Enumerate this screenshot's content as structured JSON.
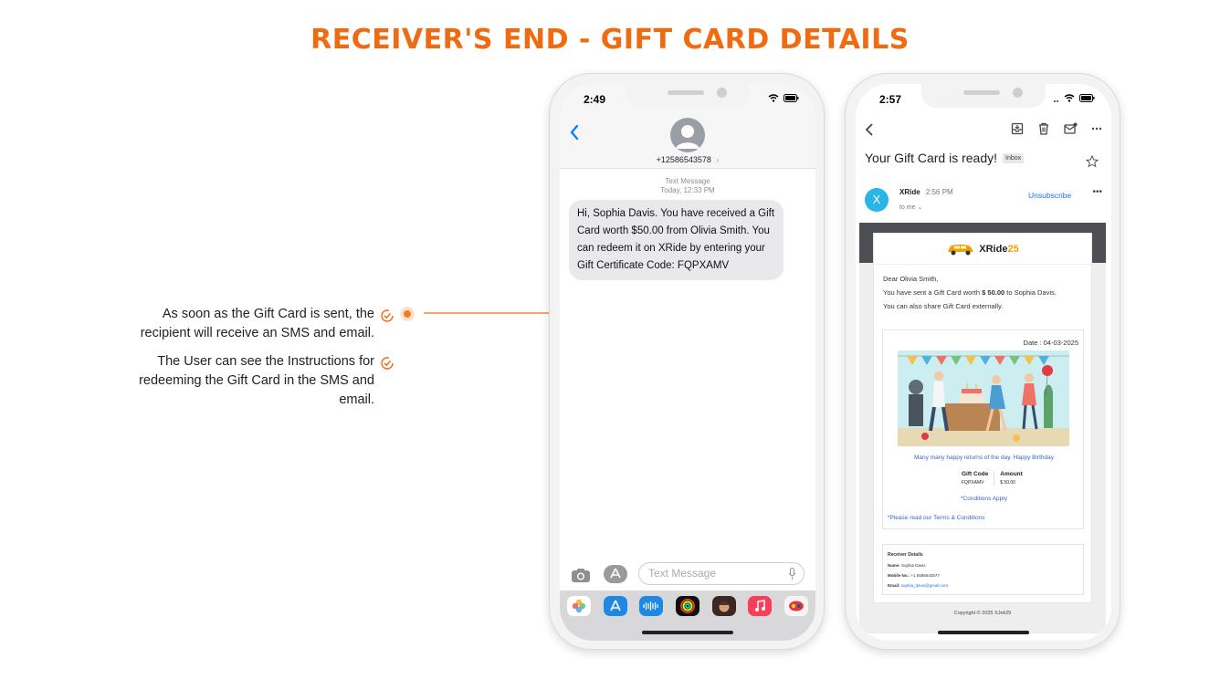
{
  "page": {
    "title": "RECEIVER'S END - GIFT CARD DETAILS"
  },
  "notes": [
    "As soon as the Gift Card is sent, the recipient will receive an SMS and email.",
    "The User can see the Instructions for redeeming the Gift Card in the SMS and email."
  ],
  "colors": {
    "accent": "#f06b0f",
    "imessage_blue": "#007aff",
    "link_blue": "#1a73e8"
  },
  "sms_phone": {
    "time": "2:49",
    "contact_number": "+12586543578",
    "meta_label": "Text Message",
    "meta_time": "Today, 12:33 PM",
    "message": "Hi, Sophia Davis. You have received a Gift Card worth $50.00 from Olivia Smith. You can redeem it on XRide by entering your Gift Certificate Code: FQPXAMV",
    "input_placeholder": "Text Message",
    "tray_apps": [
      "photos-icon",
      "app-store-icon",
      "audio-message-icon",
      "fitness-icon",
      "memoji-icon",
      "music-icon",
      "game-icon"
    ]
  },
  "email_phone": {
    "time": "2:57",
    "subject": "Your Gift Card is ready!",
    "inbox_label": "Inbox",
    "sender_initial": "X",
    "sender_name": "XRide",
    "sender_time": "2:56 PM",
    "to_me": "to me",
    "unsubscribe": "Unsubscribe",
    "email": {
      "brand_name": "XRide",
      "brand_suffix": "25",
      "greeting": "Dear Olivia Smith,",
      "line1_prefix": "You have sent a Gift Card worth",
      "line1_amount": "$ 50.00",
      "line1_suffix": "to Sophia Davis.",
      "line2": "You can also share Gift Card externally.",
      "date": "Date : 04-03-2025",
      "wish": "Many many happy returns of the day. Happy Birthday",
      "gift_code_label": "Gift Code",
      "gift_code": "FQPXAMV",
      "amount_label": "Amount",
      "amount": "$ 50.00",
      "conditions": "*Conditions Apply",
      "terms": "*Please read our Terms & Conditions",
      "receiver_title": "Receiver Details",
      "receiver_name_label": "Name:",
      "receiver_name": "Sophia Davis",
      "receiver_mobile_label": "Mobile No.:",
      "receiver_mobile": "+1 6586543577",
      "receiver_email_label": "Email:",
      "receiver_email": "sophia_davis@gmail.com",
      "copyright": "Copyright © 2025 XJek25"
    }
  }
}
